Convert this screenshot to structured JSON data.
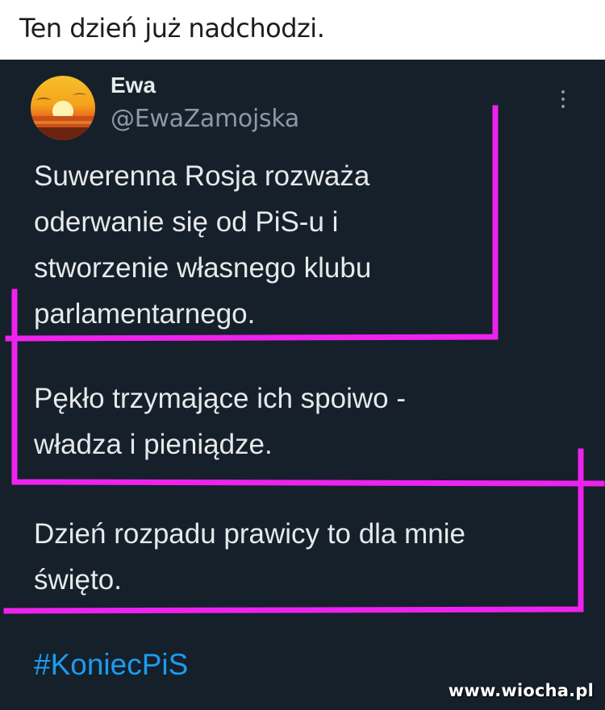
{
  "caption": "Ten dzień już nadchodzi.",
  "tweet": {
    "author_name": "Ewa",
    "author_handle": "@EwaZamojska",
    "avatar_icon": "sunset-avatar",
    "more_icon": "vertical-ellipsis-icon",
    "paragraphs": [
      [
        "Suwerenna Rosja rozważa",
        "oderwanie się od PiS-u i",
        "stworzenie własnego klubu",
        "parlamentarnego."
      ],
      [
        "Pękło trzymające ich spoiwo -",
        "władza i  pieniądze."
      ],
      [
        "Dzień rozpadu prawicy to dla mnie",
        "święto."
      ]
    ],
    "hashtag": "#KoniecPiS"
  },
  "watermark": "www.wiocha.pl",
  "colors": {
    "background": "#15202b",
    "text": "#e7e9ea",
    "handle": "#8b98a5",
    "hashtag": "#1d9bf0",
    "annotation": "#ee22ee"
  }
}
